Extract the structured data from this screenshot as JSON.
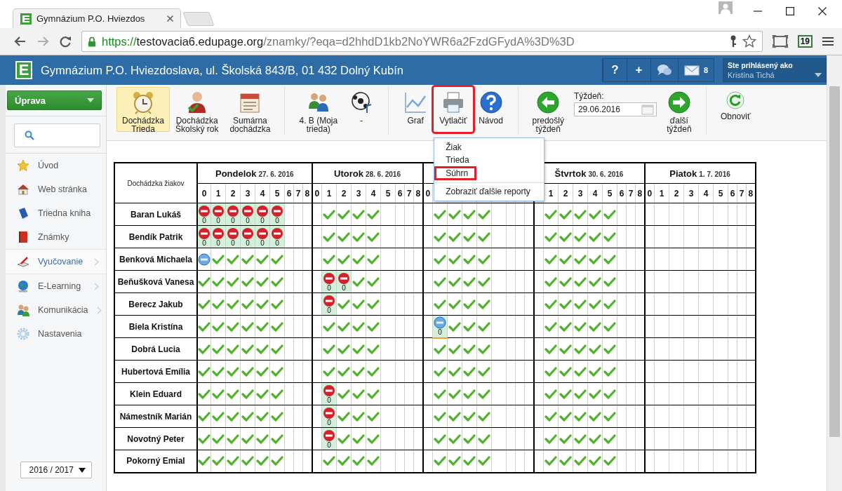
{
  "browser": {
    "tab_title": "Gymnázium P.O. Hviezdos",
    "url_scheme": "https://",
    "url_host": "testovacia6.edupage.org",
    "url_path": "/znamky/?eqa=d2hhdD1kb2NoYWR6a2FzdGFydA%3D%3D",
    "extension_badge": "19"
  },
  "header": {
    "logo": "E",
    "title": "Gymnázium P.O. Hviezdoslava, ul. Školská 843/B, 01 432 Dolný Kubín",
    "buttons": [
      "?",
      "+"
    ],
    "messages": "8",
    "user_caption": "Ste prihlásený ako",
    "user_name": "Kristína Tichá"
  },
  "sidebar": {
    "menu_button": "Úprava",
    "items": [
      {
        "label": "Úvod",
        "selected": false,
        "submenu": false
      },
      {
        "label": "Web stránka",
        "selected": false,
        "submenu": false
      },
      {
        "label": "Triedna kniha",
        "selected": false,
        "submenu": false
      },
      {
        "label": "Známky",
        "selected": false,
        "submenu": false
      },
      {
        "label": "Vyučovanie",
        "selected": true,
        "submenu": true
      },
      {
        "label": "E-Learning",
        "selected": false,
        "submenu": true
      },
      {
        "label": "Komunikácia",
        "selected": false,
        "submenu": true
      },
      {
        "label": "Nastavenia",
        "selected": false,
        "submenu": false
      }
    ],
    "year": "2016 / 2017"
  },
  "toolbar": {
    "items": [
      {
        "kind": "button",
        "label": "Dochádzka\nTrieda",
        "selected": true,
        "highlighted": false
      },
      {
        "kind": "button",
        "label": "Dochádzka\nŠkolský rok",
        "selected": false,
        "highlighted": false
      },
      {
        "kind": "button",
        "label": "Sumárna\ndochádzka",
        "selected": false,
        "highlighted": false
      },
      {
        "kind": "separator"
      },
      {
        "kind": "button",
        "label": "4. B (Moja\ntrieda)",
        "selected": false,
        "highlighted": false
      },
      {
        "kind": "button",
        "label": "-",
        "selected": false,
        "highlighted": false
      },
      {
        "kind": "separator"
      },
      {
        "kind": "button",
        "label": "Graf",
        "selected": false,
        "highlighted": false
      },
      {
        "kind": "button",
        "label": "Vytlačiť",
        "selected": false,
        "highlighted": true,
        "menu": {
          "expanded": true,
          "items": [
            {
              "kind": "item",
              "label": "Žiak",
              "highlighted": false
            },
            {
              "kind": "item",
              "label": "Trieda",
              "highlighted": false
            },
            {
              "kind": "item",
              "label": "Súhrn",
              "highlighted": true
            },
            {
              "kind": "separator"
            },
            {
              "kind": "item",
              "label": "Zobraziť ďalšie reporty",
              "highlighted": false
            }
          ]
        }
      },
      {
        "kind": "button",
        "label": "Návod",
        "selected": false,
        "highlighted": false
      },
      {
        "kind": "separator"
      },
      {
        "kind": "button",
        "label": "predošlý\ntýždeň",
        "selected": false,
        "highlighted": false
      },
      {
        "kind": "date",
        "label": "Týždeň:",
        "value": "29.06.2016"
      },
      {
        "kind": "button",
        "label": "ďalší\ntýždeň",
        "selected": false,
        "highlighted": false
      },
      {
        "kind": "separator"
      },
      {
        "kind": "button",
        "label": "Obnoviť",
        "selected": false,
        "highlighted": false
      }
    ]
  },
  "table": {
    "corner": "Dochádzka žiakov",
    "days": [
      {
        "kind": "full",
        "name": "Pondelok",
        "date": "27. 6. 2016",
        "periods": [
          "0",
          "1",
          "2",
          "3",
          "4",
          "5",
          "6",
          "7",
          "8"
        ]
      },
      {
        "kind": "full",
        "name": "Utorok",
        "date": "28. 6. 2016",
        "periods": [
          "0",
          "1",
          "2",
          "3",
          "4",
          "5",
          "6",
          "7",
          "8"
        ]
      },
      {
        "kind": "head",
        "periods": [
          "0"
        ]
      },
      {
        "kind": "tail",
        "name": "Štvrtok",
        "date": "30. 6. 2016",
        "periods": [
          "1",
          "2",
          "3",
          "4",
          "5",
          "6",
          "7",
          "8"
        ]
      },
      {
        "kind": "full",
        "name": "Piatok",
        "date": "1. 7. 2016",
        "periods": [
          "0",
          "1",
          "2",
          "3",
          "4",
          "5",
          "6",
          "7",
          "8"
        ]
      }
    ],
    "rows": [
      {
        "name": "Baran Lukáš",
        "days": [
          [
            {
              "kind": "absent",
              "note": "0"
            },
            {
              "kind": "absent",
              "note": "0"
            },
            {
              "kind": "absent",
              "note": "0"
            },
            {
              "kind": "absent",
              "note": "0"
            },
            {
              "kind": "absent",
              "note": "0"
            },
            {
              "kind": "absent",
              "note": "0"
            }
          ],
          [
            {
              "kind": "none"
            },
            {
              "kind": "ok"
            },
            {
              "kind": "ok"
            },
            {
              "kind": "ok"
            },
            {
              "kind": "ok"
            }
          ],
          [
            {
              "kind": "none"
            },
            {
              "kind": "ok"
            },
            {
              "kind": "ok"
            },
            {
              "kind": "ok"
            },
            {
              "kind": "ok"
            }
          ],
          [
            {
              "kind": "none"
            },
            {
              "kind": "ok"
            },
            {
              "kind": "ok"
            },
            {
              "kind": "ok"
            },
            {
              "kind": "ok"
            },
            {
              "kind": "ok"
            }
          ]
        ]
      },
      {
        "name": "Bendík Patrik",
        "days": [
          [
            {
              "kind": "absent",
              "note": "0"
            },
            {
              "kind": "absent",
              "note": "0"
            },
            {
              "kind": "absent",
              "note": "0"
            },
            {
              "kind": "absent",
              "note": "0"
            },
            {
              "kind": "absent",
              "note": "0"
            },
            {
              "kind": "absent",
              "note": "0"
            }
          ],
          [
            {
              "kind": "none"
            },
            {
              "kind": "ok"
            },
            {
              "kind": "ok"
            },
            {
              "kind": "ok"
            },
            {
              "kind": "ok"
            }
          ],
          [
            {
              "kind": "none"
            },
            {
              "kind": "ok"
            },
            {
              "kind": "ok"
            },
            {
              "kind": "ok"
            },
            {
              "kind": "ok"
            }
          ],
          [
            {
              "kind": "none"
            },
            {
              "kind": "ok"
            },
            {
              "kind": "ok"
            },
            {
              "kind": "ok"
            },
            {
              "kind": "ok"
            },
            {
              "kind": "ok"
            }
          ]
        ]
      },
      {
        "name": "Benková Michaela",
        "days": [
          [
            {
              "kind": "special"
            },
            {
              "kind": "ok"
            },
            {
              "kind": "ok"
            },
            {
              "kind": "ok"
            },
            {
              "kind": "ok"
            },
            {
              "kind": "ok"
            }
          ],
          [
            {
              "kind": "none"
            },
            {
              "kind": "ok"
            },
            {
              "kind": "ok"
            },
            {
              "kind": "ok"
            },
            {
              "kind": "ok"
            }
          ],
          [
            {
              "kind": "none"
            },
            {
              "kind": "ok"
            },
            {
              "kind": "ok"
            },
            {
              "kind": "ok"
            },
            {
              "kind": "ok"
            }
          ],
          [
            {
              "kind": "none"
            },
            {
              "kind": "ok"
            },
            {
              "kind": "ok"
            },
            {
              "kind": "ok"
            },
            {
              "kind": "ok"
            },
            {
              "kind": "ok"
            }
          ]
        ]
      },
      {
        "name": "Beňušková Vanesa",
        "days": [
          [
            {
              "kind": "ok"
            },
            {
              "kind": "ok"
            },
            {
              "kind": "ok"
            },
            {
              "kind": "ok"
            },
            {
              "kind": "ok"
            },
            {
              "kind": "ok"
            }
          ],
          [
            {
              "kind": "none"
            },
            {
              "kind": "absent",
              "note": "0"
            },
            {
              "kind": "absent",
              "note": "0"
            },
            {
              "kind": "ok"
            },
            {
              "kind": "ok"
            }
          ],
          [
            {
              "kind": "none"
            },
            {
              "kind": "ok"
            },
            {
              "kind": "ok"
            },
            {
              "kind": "ok"
            },
            {
              "kind": "ok"
            }
          ],
          [
            {
              "kind": "none"
            },
            {
              "kind": "ok"
            },
            {
              "kind": "ok"
            },
            {
              "kind": "ok"
            },
            {
              "kind": "ok"
            },
            {
              "kind": "ok"
            }
          ]
        ]
      },
      {
        "name": "Berecz Jakub",
        "days": [
          [
            {
              "kind": "ok"
            },
            {
              "kind": "ok"
            },
            {
              "kind": "ok"
            },
            {
              "kind": "ok"
            },
            {
              "kind": "ok"
            },
            {
              "kind": "ok"
            }
          ],
          [
            {
              "kind": "none"
            },
            {
              "kind": "absent",
              "note": "0"
            },
            {
              "kind": "ok"
            },
            {
              "kind": "ok"
            },
            {
              "kind": "ok"
            }
          ],
          [
            {
              "kind": "none"
            },
            {
              "kind": "ok"
            },
            {
              "kind": "ok"
            },
            {
              "kind": "ok"
            },
            {
              "kind": "ok"
            }
          ],
          [
            {
              "kind": "none"
            },
            {
              "kind": "ok"
            },
            {
              "kind": "ok"
            },
            {
              "kind": "ok"
            },
            {
              "kind": "ok"
            },
            {
              "kind": "ok"
            }
          ]
        ]
      },
      {
        "name": "Biela Kristína",
        "days": [
          [
            {
              "kind": "ok"
            },
            {
              "kind": "ok"
            },
            {
              "kind": "ok"
            },
            {
              "kind": "ok"
            },
            {
              "kind": "ok"
            },
            {
              "kind": "ok"
            }
          ],
          [
            {
              "kind": "none"
            },
            {
              "kind": "ok"
            },
            {
              "kind": "ok"
            },
            {
              "kind": "ok"
            },
            {
              "kind": "ok"
            }
          ],
          [
            {
              "kind": "none"
            },
            {
              "kind": "special",
              "note": "0"
            },
            {
              "kind": "ok"
            },
            {
              "kind": "ok"
            },
            {
              "kind": "ok"
            }
          ],
          [
            {
              "kind": "none"
            },
            {
              "kind": "ok"
            },
            {
              "kind": "ok"
            },
            {
              "kind": "ok"
            },
            {
              "kind": "ok"
            },
            {
              "kind": "ok"
            }
          ]
        ]
      },
      {
        "name": "Dobrá Lucia",
        "days": [
          [
            {
              "kind": "ok"
            },
            {
              "kind": "ok"
            },
            {
              "kind": "ok"
            },
            {
              "kind": "ok"
            },
            {
              "kind": "ok"
            },
            {
              "kind": "ok"
            }
          ],
          [
            {
              "kind": "none"
            },
            {
              "kind": "ok"
            },
            {
              "kind": "ok"
            },
            {
              "kind": "ok"
            },
            {
              "kind": "ok"
            }
          ],
          [
            {
              "kind": "none"
            },
            {
              "kind": "ok"
            },
            {
              "kind": "ok"
            },
            {
              "kind": "ok"
            },
            {
              "kind": "ok"
            }
          ],
          [
            {
              "kind": "none"
            },
            {
              "kind": "ok"
            },
            {
              "kind": "ok"
            },
            {
              "kind": "ok"
            },
            {
              "kind": "ok"
            },
            {
              "kind": "ok"
            }
          ]
        ]
      },
      {
        "name": "Hubertová Emília",
        "days": [
          [
            {
              "kind": "ok"
            },
            {
              "kind": "ok"
            },
            {
              "kind": "ok"
            },
            {
              "kind": "ok"
            },
            {
              "kind": "ok"
            },
            {
              "kind": "ok"
            }
          ],
          [
            {
              "kind": "none"
            },
            {
              "kind": "ok"
            },
            {
              "kind": "ok"
            },
            {
              "kind": "ok"
            },
            {
              "kind": "ok"
            }
          ],
          [
            {
              "kind": "none"
            },
            {
              "kind": "ok"
            },
            {
              "kind": "ok"
            },
            {
              "kind": "ok"
            },
            {
              "kind": "ok"
            }
          ],
          [
            {
              "kind": "none"
            },
            {
              "kind": "ok"
            },
            {
              "kind": "ok"
            },
            {
              "kind": "ok"
            },
            {
              "kind": "ok"
            },
            {
              "kind": "ok"
            }
          ]
        ]
      },
      {
        "name": "Klein Eduard",
        "days": [
          [
            {
              "kind": "ok"
            },
            {
              "kind": "ok"
            },
            {
              "kind": "ok"
            },
            {
              "kind": "ok"
            },
            {
              "kind": "ok"
            },
            {
              "kind": "ok"
            }
          ],
          [
            {
              "kind": "none"
            },
            {
              "kind": "absent",
              "note": "0"
            },
            {
              "kind": "ok"
            },
            {
              "kind": "ok"
            },
            {
              "kind": "ok"
            }
          ],
          [
            {
              "kind": "none"
            },
            {
              "kind": "ok"
            },
            {
              "kind": "ok"
            },
            {
              "kind": "ok"
            },
            {
              "kind": "ok"
            }
          ],
          [
            {
              "kind": "none"
            },
            {
              "kind": "ok"
            },
            {
              "kind": "ok"
            },
            {
              "kind": "ok"
            },
            {
              "kind": "ok"
            },
            {
              "kind": "ok"
            }
          ]
        ]
      },
      {
        "name": "Námestník Marián",
        "days": [
          [
            {
              "kind": "ok"
            },
            {
              "kind": "ok"
            },
            {
              "kind": "ok"
            },
            {
              "kind": "ok"
            },
            {
              "kind": "ok"
            },
            {
              "kind": "ok"
            }
          ],
          [
            {
              "kind": "none"
            },
            {
              "kind": "absent",
              "note": "0"
            },
            {
              "kind": "ok"
            },
            {
              "kind": "ok"
            },
            {
              "kind": "ok"
            }
          ],
          [
            {
              "kind": "none"
            },
            {
              "kind": "ok"
            },
            {
              "kind": "ok"
            },
            {
              "kind": "ok"
            },
            {
              "kind": "ok"
            }
          ],
          [
            {
              "kind": "none"
            },
            {
              "kind": "ok"
            },
            {
              "kind": "ok"
            },
            {
              "kind": "ok"
            },
            {
              "kind": "ok"
            },
            {
              "kind": "ok"
            }
          ]
        ]
      },
      {
        "name": "Novotný Peter",
        "days": [
          [
            {
              "kind": "ok"
            },
            {
              "kind": "ok"
            },
            {
              "kind": "ok"
            },
            {
              "kind": "ok"
            },
            {
              "kind": "ok"
            },
            {
              "kind": "ok"
            }
          ],
          [
            {
              "kind": "none"
            },
            {
              "kind": "absent",
              "note": "0"
            },
            {
              "kind": "ok"
            },
            {
              "kind": "ok"
            },
            {
              "kind": "ok"
            }
          ],
          [
            {
              "kind": "none"
            },
            {
              "kind": "ok"
            },
            {
              "kind": "ok"
            },
            {
              "kind": "ok"
            },
            {
              "kind": "ok"
            }
          ],
          [
            {
              "kind": "none"
            },
            {
              "kind": "ok"
            },
            {
              "kind": "ok"
            },
            {
              "kind": "ok"
            },
            {
              "kind": "ok"
            },
            {
              "kind": "ok"
            }
          ]
        ]
      },
      {
        "name": "Pokorný Emial",
        "days": [
          [
            {
              "kind": "ok"
            },
            {
              "kind": "ok"
            },
            {
              "kind": "ok"
            },
            {
              "kind": "ok"
            },
            {
              "kind": "ok"
            },
            {
              "kind": "ok"
            }
          ],
          [
            {
              "kind": "none"
            },
            {
              "kind": "ok"
            },
            {
              "kind": "ok"
            },
            {
              "kind": "ok"
            },
            {
              "kind": "ok"
            }
          ],
          [
            {
              "kind": "none"
            },
            {
              "kind": "ok"
            },
            {
              "kind": "ok"
            },
            {
              "kind": "ok"
            },
            {
              "kind": "ok"
            }
          ],
          [
            {
              "kind": "none"
            },
            {
              "kind": "ok"
            },
            {
              "kind": "ok"
            },
            {
              "kind": "ok"
            },
            {
              "kind": "ok"
            },
            {
              "kind": "ok"
            }
          ]
        ]
      }
    ]
  }
}
